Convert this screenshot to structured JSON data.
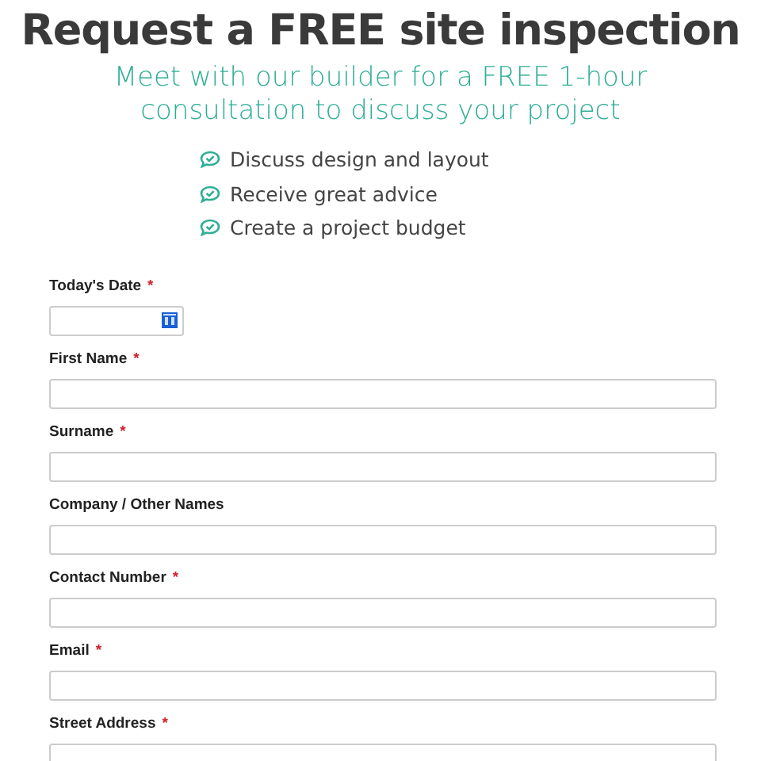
{
  "title": "Request a FREE site inspection",
  "subtitle": "Meet with our builder for a FREE 1-hour consultation to discuss your project",
  "benefits": [
    "Discuss design and layout",
    "Receive great advice",
    "Create a project budget"
  ],
  "fields": [
    {
      "label": "Today's Date",
      "required_mark": "*",
      "kind": "date"
    },
    {
      "label": "First Name",
      "required_mark": "*",
      "kind": "text"
    },
    {
      "label": "Surname",
      "required_mark": "*",
      "kind": "text"
    },
    {
      "label": "Company / Other Names",
      "kind": "text"
    },
    {
      "label": "Contact Number",
      "required_mark": "*",
      "kind": "text"
    },
    {
      "label": "Email",
      "required_mark": "*",
      "kind": "text"
    },
    {
      "label": "Street Address",
      "required_mark": "*",
      "kind": "text"
    }
  ]
}
